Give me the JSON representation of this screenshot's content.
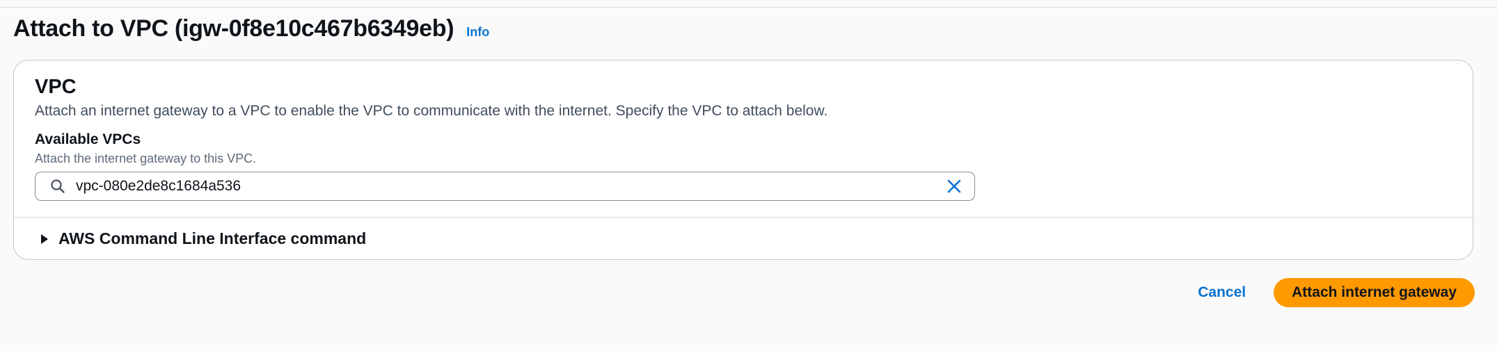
{
  "header": {
    "title": "Attach to VPC (igw-0f8e10c467b6349eb)",
    "info_link": "Info"
  },
  "vpc_section": {
    "title": "VPC",
    "description": "Attach an internet gateway to a VPC to enable the VPC to communicate with the internet. Specify the VPC to attach below.",
    "field": {
      "label": "Available VPCs",
      "hint": "Attach the internet gateway to this VPC.",
      "value": "vpc-080e2de8c1684a536",
      "leading_icon": "search-icon",
      "trailing_icon": "close-icon"
    },
    "cli_expander": {
      "label": "AWS Command Line Interface command",
      "icon": "caret-right-icon",
      "expanded": false
    }
  },
  "actions": {
    "cancel_label": "Cancel",
    "submit_label": "Attach internet gateway"
  },
  "colors": {
    "accent_link": "#0972d3",
    "primary_button": "#ff9900",
    "page_background": "#fafafa",
    "card_border": "#c6c6cd"
  }
}
